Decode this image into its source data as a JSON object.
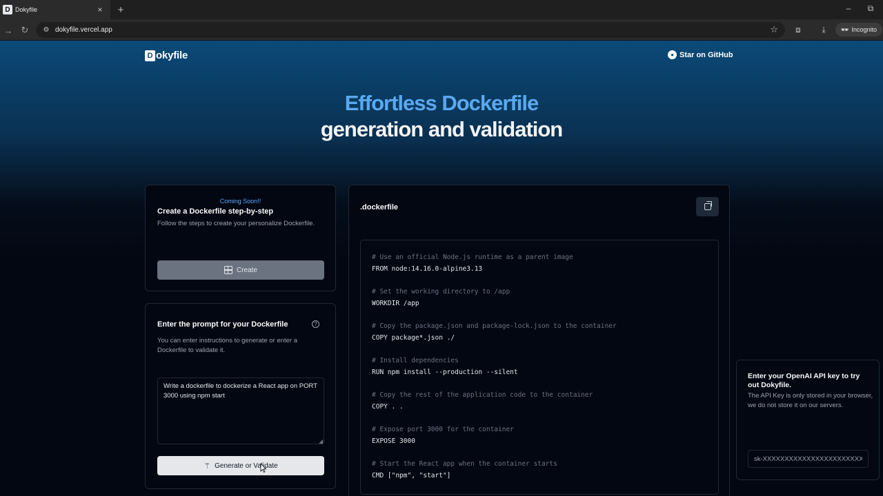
{
  "browser": {
    "tab_title": "Dokyfile",
    "tab_close": "×",
    "new_tab": "+",
    "url": "dokyfile.vercel.app",
    "incognito_label": "Incognito",
    "minimize": "–",
    "restore": "⧉"
  },
  "header": {
    "logo_mark": "D",
    "logo_text": "okyfile",
    "github_label": "Star on GitHub"
  },
  "hero": {
    "line1": "Effortless Dockerfile",
    "line2": "generation and validation"
  },
  "create_card": {
    "badge": "Coming Soon!!",
    "title": "Create a Dockerfile step-by-step",
    "description": "Follow the steps to create your personalize Dockerfile.",
    "button_label": "Create"
  },
  "prompt_card": {
    "title": "Enter the prompt for your Dockerfile",
    "description": "You can enter instructions to generate or enter a Dockerfile to validate it.",
    "textarea_value": "Write a dockerfile to dockerize a React app on PORT 3000 using npm start",
    "button_label": "Generate or Validate"
  },
  "dockerfile_card": {
    "title": ".dockerfile",
    "code_lines": [
      {
        "text": "# Use an official Node.js runtime as a parent image",
        "comment": true
      },
      {
        "text": "FROM node:14.16.0-alpine3.13",
        "comment": false
      },
      {
        "text": "",
        "comment": false
      },
      {
        "text": "# Set the working directory to /app",
        "comment": true
      },
      {
        "text": "WORKDIR /app",
        "comment": false
      },
      {
        "text": "",
        "comment": false
      },
      {
        "text": "# Copy the package.json and package-lock.json to the container",
        "comment": true
      },
      {
        "text": "COPY package*.json ./",
        "comment": false
      },
      {
        "text": "",
        "comment": false
      },
      {
        "text": "# Install dependencies",
        "comment": true
      },
      {
        "text": "RUN npm install --production --silent",
        "comment": false
      },
      {
        "text": "",
        "comment": false
      },
      {
        "text": "# Copy the rest of the application code to the container",
        "comment": true
      },
      {
        "text": "COPY . .",
        "comment": false
      },
      {
        "text": "",
        "comment": false
      },
      {
        "text": "# Expose port 3000 for the container",
        "comment": true
      },
      {
        "text": "EXPOSE 3000",
        "comment": false
      },
      {
        "text": "",
        "comment": false
      },
      {
        "text": "# Start the React app when the container starts",
        "comment": true
      },
      {
        "text": "CMD [\"npm\", \"start\"]",
        "comment": false
      }
    ]
  },
  "api_card": {
    "title": "Enter your OpenAI API key to try out Dokyfile.",
    "description": "The API Key is only stored in your browser, we do not store it on our servers.",
    "input_value": "sk-XXXXXXXXXXXXXXXXXXXXXXXX"
  },
  "colors": {
    "accent_blue": "#5aa9f0",
    "page_bg": "#030712",
    "header_gradient_top": "#0b4a78"
  }
}
